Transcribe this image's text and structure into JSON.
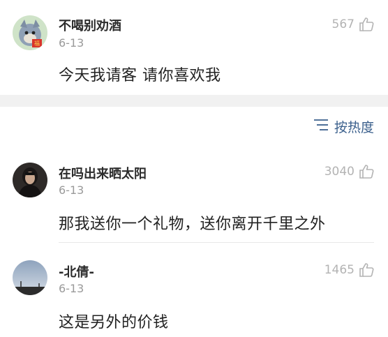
{
  "top_comment": {
    "username": "不喝别劝酒",
    "date": "6-13",
    "text": "今天我请客  请你喜欢我",
    "likes": "567",
    "avatar_icon": "cartoon-cat-avatar"
  },
  "sort": {
    "label": "按热度",
    "icon": "sort-lines-icon",
    "color": "#3a5f8c"
  },
  "comments": [
    {
      "username": "在吗出来晒太阳",
      "date": "6-13",
      "text": "那我送你一个礼物，送你离开千里之外",
      "likes": "3040",
      "avatar_icon": "person-photo-avatar"
    },
    {
      "username": "-北倩-",
      "date": "6-13",
      "text": "这是另外的价钱",
      "likes": "1465",
      "avatar_icon": "sky-landscape-avatar"
    }
  ]
}
